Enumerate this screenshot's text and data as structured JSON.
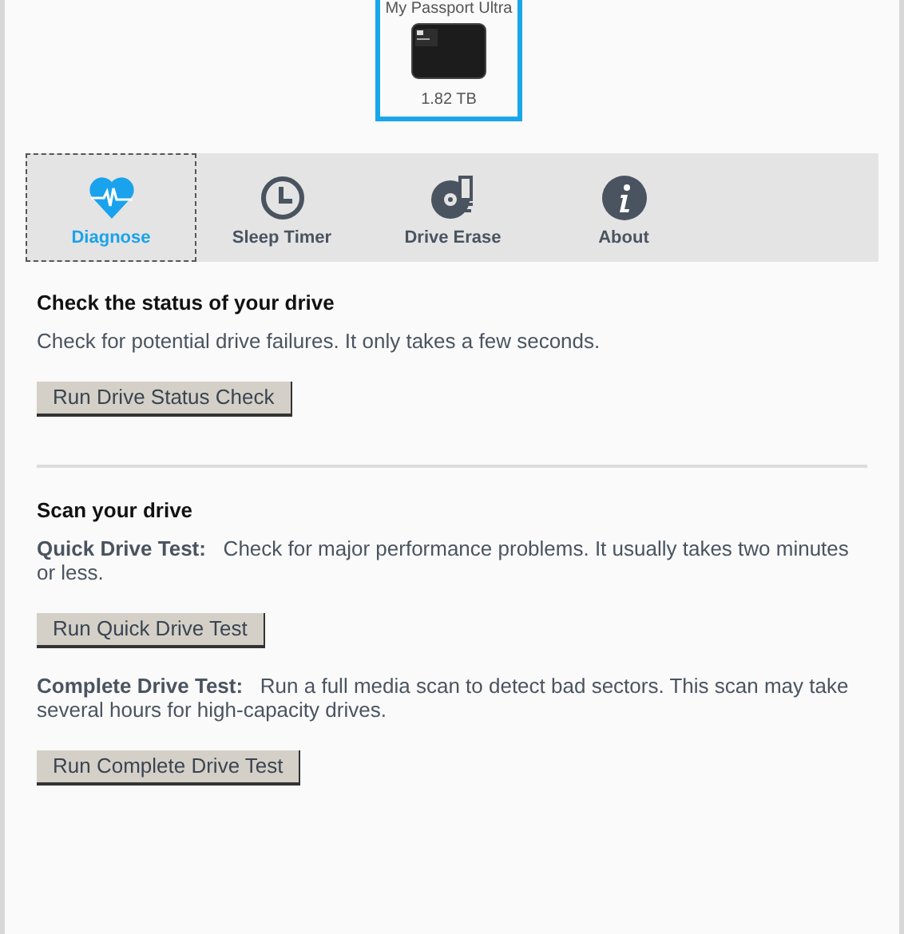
{
  "device": {
    "name": "My Passport Ultra",
    "capacity": "1.82 TB",
    "selected": true
  },
  "tabs": [
    {
      "label": "Diagnose",
      "kind": "heart",
      "selected": true
    },
    {
      "label": "Sleep Timer",
      "kind": "clock",
      "selected": false
    },
    {
      "label": "Drive Erase",
      "kind": "disc",
      "selected": false
    },
    {
      "label": "About",
      "kind": "info",
      "selected": false
    }
  ],
  "sections": [
    {
      "heading": "Check the status of your drive",
      "items": [
        {
          "text": "Check for potential drive failures. It only takes a few seconds.",
          "button": "Run Drive Status Check"
        }
      ]
    },
    {
      "heading": "Scan your drive",
      "items": [
        {
          "text": "**Quick Drive Test:**   Check for major performance problems. It usually takes two minutes or less.",
          "button": "Run Quick Drive Test"
        },
        {
          "text": "**Complete Drive Test:**   Run a full media scan to detect bad sectors. This scan may take several hours for high-capacity drives.",
          "button": "Run Complete Drive Test"
        }
      ]
    }
  ]
}
